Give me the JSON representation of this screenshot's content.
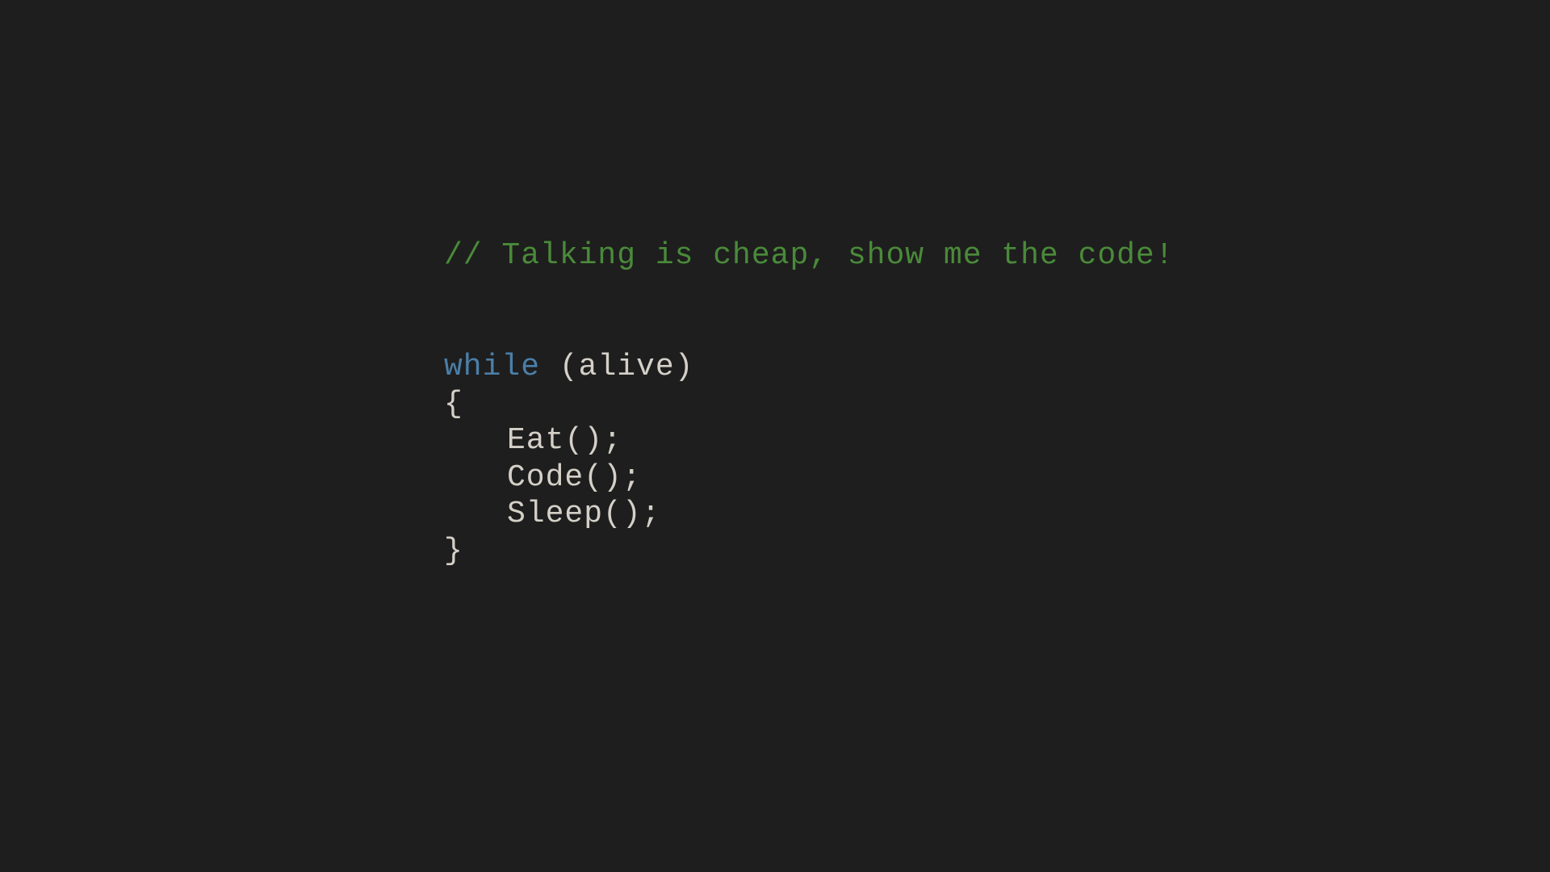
{
  "code": {
    "comment": "// Talking is cheap, show me the code!",
    "keyword_while": "while",
    "condition": " (alive)",
    "brace_open": "{",
    "statement1": "Eat();",
    "statement2": "Code();",
    "statement3": "Sleep();",
    "brace_close": "}"
  },
  "colors": {
    "background": "#1e1e1e",
    "comment": "#4a8a3a",
    "keyword": "#4a7fa8",
    "default": "#d4d0c8"
  }
}
